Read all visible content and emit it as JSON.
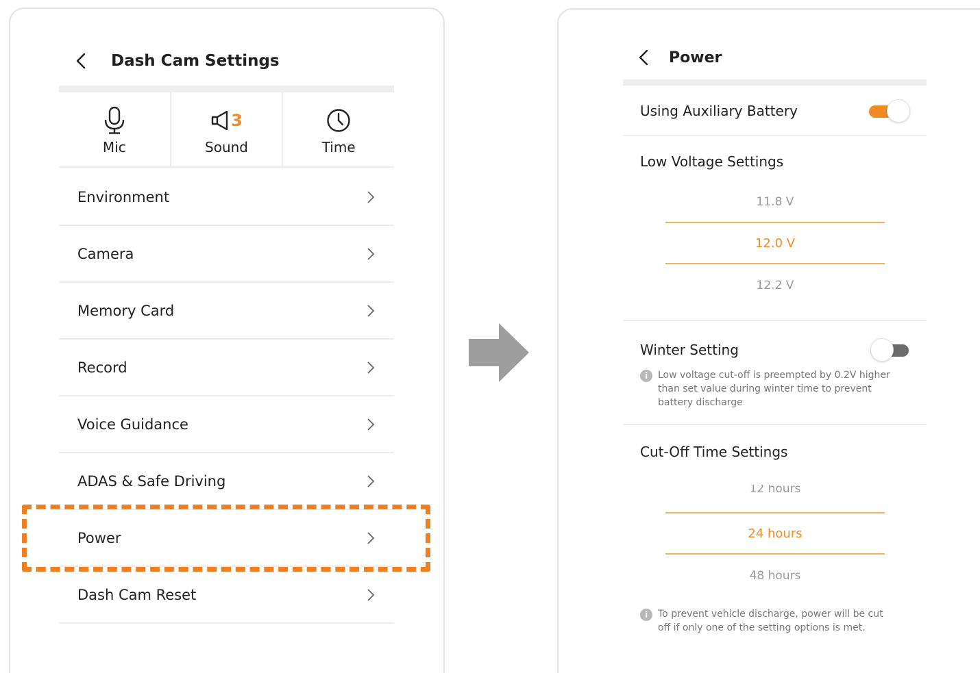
{
  "left_screen": {
    "title": "Dash Cam Settings",
    "quick": [
      {
        "label": "Mic",
        "icon": "mic-icon"
      },
      {
        "label": "Sound",
        "icon": "speaker-icon",
        "badge": "3"
      },
      {
        "label": "Time",
        "icon": "clock-icon"
      }
    ],
    "menu": [
      {
        "label": "Environment"
      },
      {
        "label": "Camera"
      },
      {
        "label": "Memory Card"
      },
      {
        "label": "Record"
      },
      {
        "label": "Voice Guidance"
      },
      {
        "label": "ADAS & Safe Driving"
      },
      {
        "label": "Power"
      },
      {
        "label": "Dash Cam Reset"
      }
    ],
    "highlighted_item": "Power"
  },
  "right_screen": {
    "title": "Power",
    "aux_battery": {
      "label": "Using Auxiliary Battery",
      "on": true
    },
    "low_voltage": {
      "label": "Low Voltage Settings",
      "options": [
        "11.8 V",
        "12.0 V",
        "12.2 V"
      ],
      "selected": "12.0 V"
    },
    "winter": {
      "label": "Winter Setting",
      "on": false,
      "info": "Low voltage cut-off is preempted by 0.2V higher than set value during winter time to prevent battery discharge"
    },
    "cutoff": {
      "label": "Cut-Off Time Settings",
      "options": [
        "12 hours",
        "24 hours",
        "48 hours"
      ],
      "selected": "24 hours"
    },
    "footer_info": "To prevent vehicle discharge, power will be cut off if only one of the setting options is met."
  },
  "colors": {
    "accent": "#f08a24",
    "highlight_border": "#f07f22",
    "arrow": "#9e9e9e",
    "divider": "#eeeeee"
  }
}
